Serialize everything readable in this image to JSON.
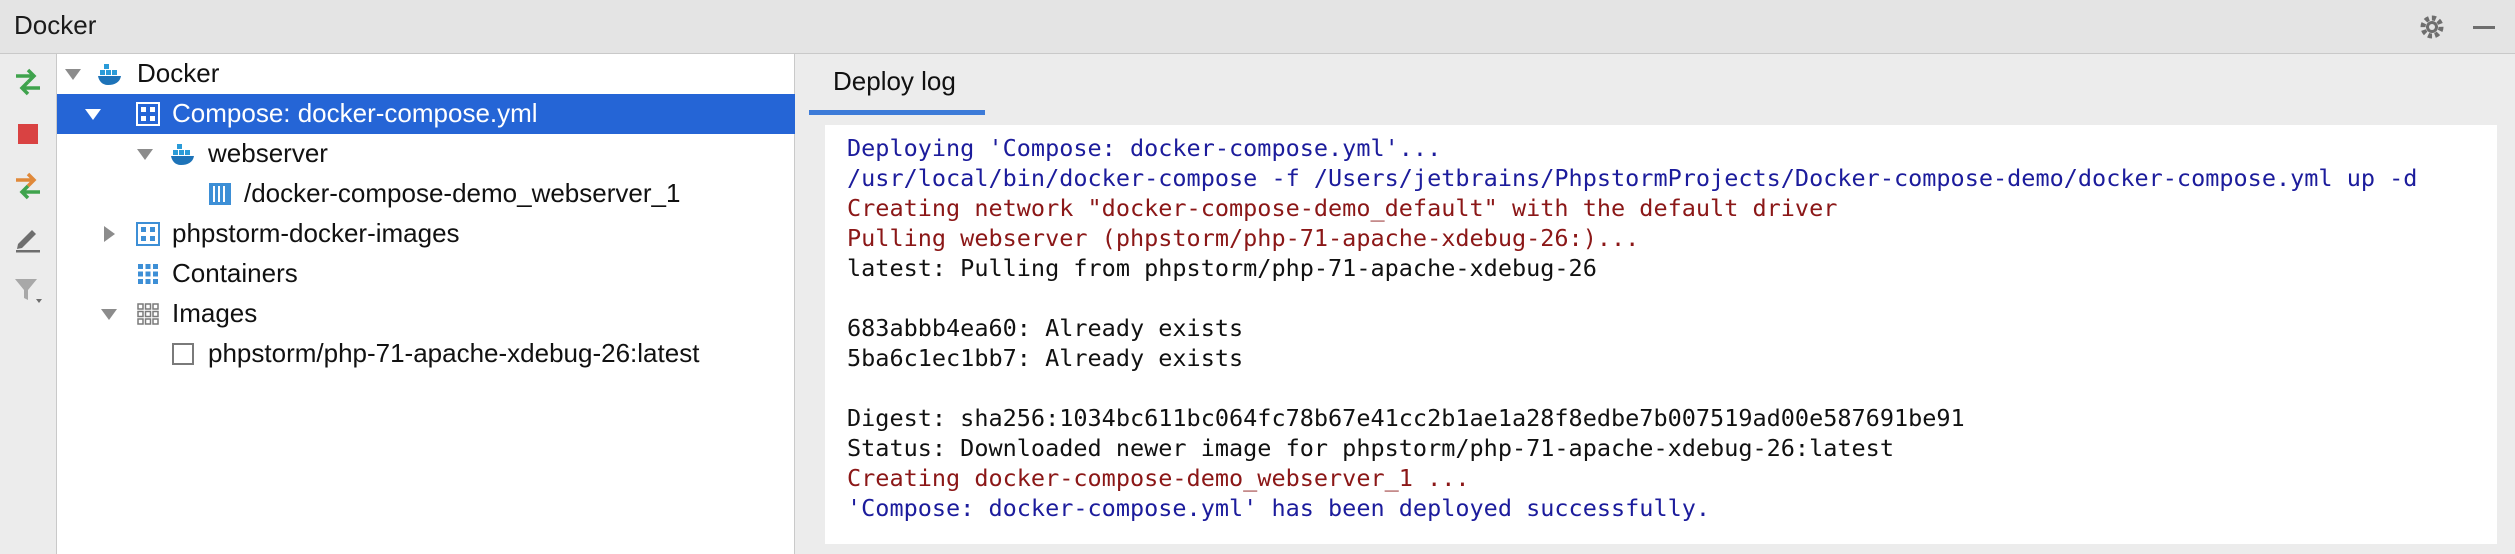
{
  "window": {
    "title": "Docker"
  },
  "tree": [
    {
      "label": "Docker",
      "icon": "docker-whale-icon",
      "expanded": true
    },
    {
      "label": "Compose: docker-compose.yml",
      "icon": "compose-icon",
      "expanded": true,
      "selected": true
    },
    {
      "label": "webserver",
      "icon": "docker-whale-icon",
      "expanded": true
    },
    {
      "label": "/docker-compose-demo_webserver_1",
      "icon": "container-running-icon"
    },
    {
      "label": "phpstorm-docker-images",
      "icon": "compose-icon",
      "expanded": false
    },
    {
      "label": "Containers",
      "icon": "containers-grid-icon"
    },
    {
      "label": "Images",
      "icon": "images-grid-icon",
      "expanded": true
    },
    {
      "label": "phpstorm/php-71-apache-xdebug-26:latest",
      "icon": "image-icon"
    }
  ],
  "tabs": [
    {
      "label": "Deploy log",
      "active": true
    }
  ],
  "log": [
    {
      "text": "Deploying 'Compose: docker-compose.yml'...",
      "color": "#1c1c9c"
    },
    {
      "text": "/usr/local/bin/docker-compose -f /Users/jetbrains/PhpstormProjects/Docker-compose-demo/docker-compose.yml up -d",
      "color": "#1c1c9c"
    },
    {
      "text": "Creating network \"docker-compose-demo_default\" with the default driver",
      "color": "#8b1717"
    },
    {
      "text": "Pulling webserver (phpstorm/php-71-apache-xdebug-26:)...",
      "color": "#8b1717"
    },
    {
      "text": "latest: Pulling from phpstorm/php-71-apache-xdebug-26",
      "color": "#111111"
    },
    {
      "text": "",
      "color": "#111111"
    },
    {
      "text": "683abbb4ea60: Already exists",
      "color": "#111111"
    },
    {
      "text": "5ba6c1ec1bb7: Already exists",
      "color": "#111111"
    },
    {
      "text": "",
      "color": "#111111"
    },
    {
      "text": "Digest: sha256:1034bc611bc064fc78b67e41cc2b1ae1a28f8edbe7b007519ad00e587691be91",
      "color": "#111111"
    },
    {
      "text": "Status: Downloaded newer image for phpstorm/php-71-apache-xdebug-26:latest",
      "color": "#111111"
    },
    {
      "text": "Creating docker-compose-demo_webserver_1 ...",
      "color": "#8b1717"
    },
    {
      "text": "'Compose: docker-compose.yml' has been deployed successfully.",
      "color": "#1c1c9c"
    }
  ]
}
